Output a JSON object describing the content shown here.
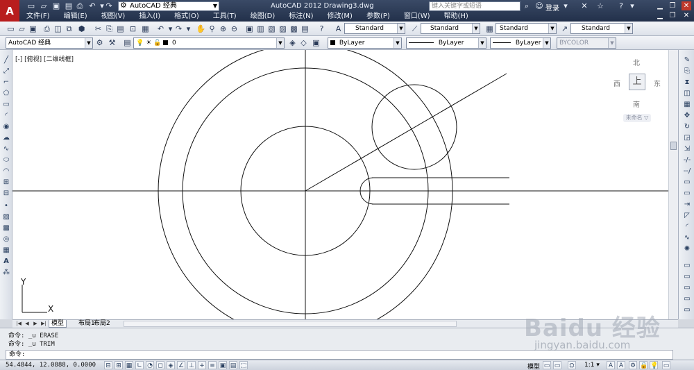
{
  "titlebar": {
    "workspace": "AutoCAD 经典",
    "title": "AutoCAD 2012    Drawing3.dwg",
    "search_placeholder": "键入关键字或短语",
    "login": "登录"
  },
  "menu": [
    "文件(F)",
    "编辑(E)",
    "视图(V)",
    "插入(I)",
    "格式(O)",
    "工具(T)",
    "绘图(D)",
    "标注(N)",
    "修改(M)",
    "参数(P)",
    "窗口(W)",
    "帮助(H)"
  ],
  "toolbar1": {
    "text_style": "Standard",
    "dim_style": "Standard",
    "table_style": "Standard",
    "mleader_style": "Standard"
  },
  "toolbar2": {
    "workspace": "AutoCAD 经典",
    "layer": "0",
    "color": "ByLayer",
    "linetype": "ByLayer",
    "lineweight": "ByLayer",
    "plotstyle": "BYCOLOR"
  },
  "viewport": {
    "label": "[-] [俯视] [二维线框]",
    "compass": {
      "north": "北",
      "south": "南",
      "east": "东",
      "west": "西",
      "top": "上"
    },
    "ucs_name": "未命名 ▽",
    "axis_x": "X",
    "axis_y": "Y"
  },
  "layout_tabs": [
    "模型",
    "布局1",
    "布局2"
  ],
  "command": {
    "history": [
      "命令:  _u ERASE",
      "命令:  _u TRIM"
    ],
    "prompt": "命令:"
  },
  "statusbar": {
    "coords": "54.4844, 12.0888, 0.0000",
    "model": "模型",
    "scale": "1:1 ▾"
  },
  "watermark": {
    "logo": "Baidu 经验",
    "url": "jingyan.baidu.com"
  },
  "colors": {
    "title_bg": "#2b3a55",
    "toolbar_bg": "#e8ebf0",
    "canvas_bg": "#ffffff",
    "logo_red": "#b81d1d"
  }
}
